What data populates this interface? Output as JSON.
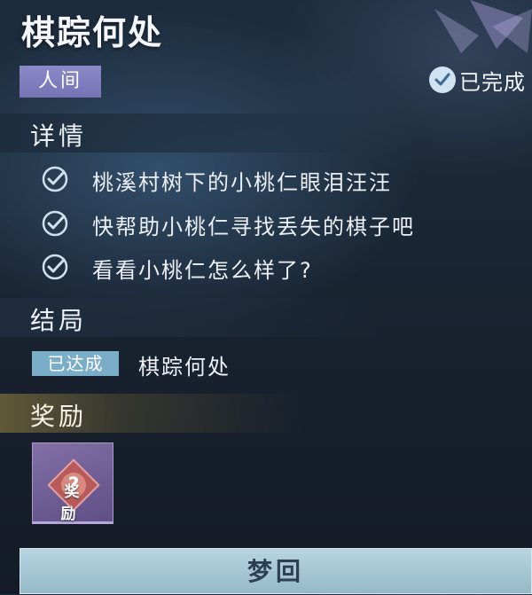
{
  "quest": {
    "title": "棋踪何处",
    "realm": "人间",
    "status": "已完成"
  },
  "details": {
    "header": "详情",
    "items": [
      "桃溪村树下的小桃仁眼泪汪汪",
      "快帮助小桃仁寻找丢失的棋子吧",
      "看看小桃仁怎么样了?"
    ]
  },
  "ending": {
    "header": "结局",
    "badge": "已达成",
    "name": "棋踪何处"
  },
  "reward": {
    "header": "奖励",
    "item_label": "奖励",
    "icon": "mystery-reward-icon"
  },
  "action": {
    "button_label": "梦回"
  },
  "colors": {
    "realm_tag": "#7f7cbf",
    "ending_badge": "#7aaec8",
    "reward_slot": "#6f5f96",
    "button": "#a9c8d6"
  }
}
